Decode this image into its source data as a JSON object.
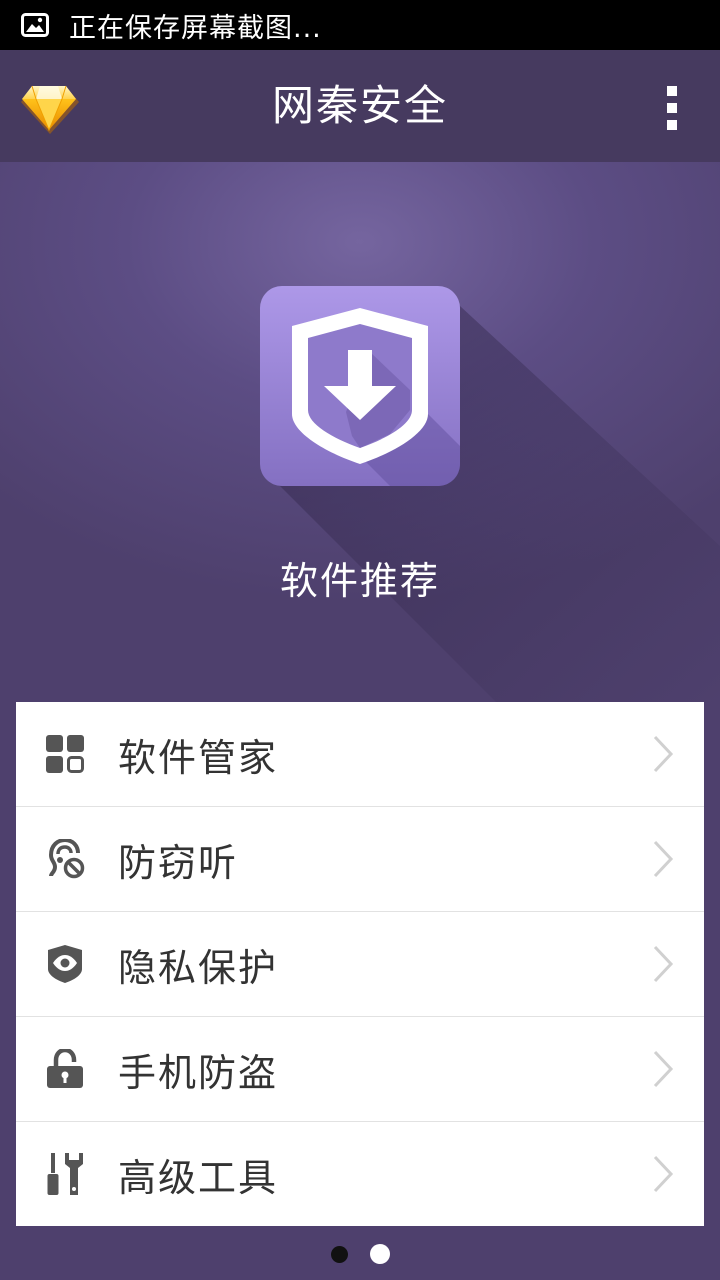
{
  "status_bar": {
    "notification_icon": "image-icon",
    "text": "正在保存屏幕截图..."
  },
  "app_bar": {
    "logo_icon": "diamond-icon",
    "title": "网秦安全",
    "more_icon": "more-vertical-icon"
  },
  "hero": {
    "icon": "shield-download-icon",
    "label": "软件推荐"
  },
  "menu": {
    "items": [
      {
        "icon": "apps-grid-icon",
        "label": "软件管家"
      },
      {
        "icon": "ear-block-icon",
        "label": "防窃听"
      },
      {
        "icon": "shield-eye-icon",
        "label": "隐私保护"
      },
      {
        "icon": "unlock-icon",
        "label": "手机防盗"
      },
      {
        "icon": "tools-icon",
        "label": "高级工具"
      }
    ]
  },
  "pager": {
    "count": 2,
    "active_index": 1
  },
  "colors": {
    "status_bar": "#000000",
    "app_bar": "#463a5f",
    "hero_accent": "#75659f",
    "icon_tile": "#9a87d3",
    "menu_icon": "#555555"
  }
}
